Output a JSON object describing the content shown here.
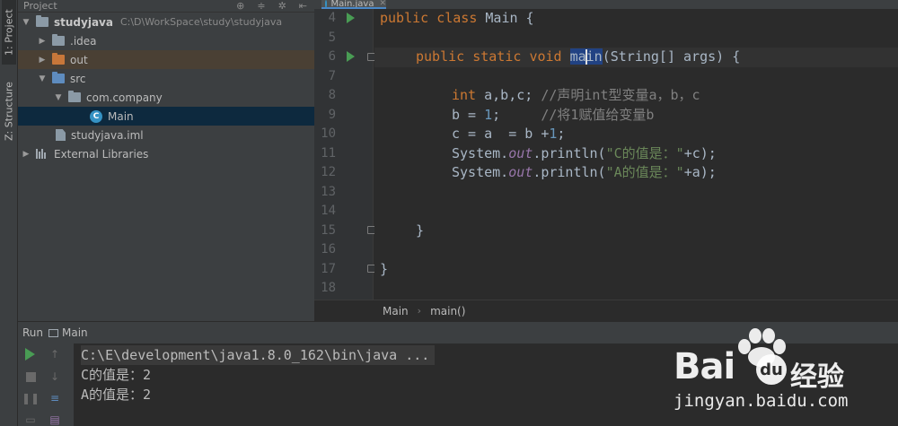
{
  "left_strip": {
    "project_tab": "1: Project",
    "structure_tab": "Z: Structure"
  },
  "project_panel": {
    "header_title": "Project",
    "tree": [
      {
        "label": "studyjava",
        "path": "C:\\D\\WorkSpace\\study\\studyjava",
        "icon": "project-folder-icon"
      },
      {
        "label": ".idea",
        "icon": "folder-icon"
      },
      {
        "label": "out",
        "icon": "folder-orange-icon"
      },
      {
        "label": "src",
        "icon": "source-folder-icon"
      },
      {
        "label": "com.company",
        "icon": "package-icon"
      },
      {
        "label": "Main",
        "icon": "java-class-icon"
      },
      {
        "label": "studyjava.iml",
        "icon": "iml-file-icon"
      },
      {
        "label": "External Libraries",
        "icon": "libraries-icon"
      }
    ]
  },
  "editor": {
    "tab_label": "Main.java",
    "line_numbers": [
      "4",
      "5",
      "6",
      "7",
      "8",
      "9",
      "10",
      "11",
      "12",
      "13",
      "14",
      "15",
      "16",
      "17",
      "18"
    ],
    "lines": {
      "l4_kw1": "public",
      "l4_kw2": "class",
      "l4_rest": " Main {",
      "l6_kw1": "public",
      "l6_kw2": "static",
      "l6_kw3": "void",
      "l6_m1": "ma",
      "l6_m2": "in",
      "l6_rest": "(String[] args) {",
      "l8_kw": "int",
      "l8_code": " a,b,c; ",
      "l8_cmt": "//声明int型变量a，b，c",
      "l9_code1": "b = ",
      "l9_num": "1",
      "l9_code2": ";     ",
      "l9_cmt": "//将1赋值给变量b",
      "l10_code1": "c = a  = b +",
      "l10_num": "1",
      "l10_code2": ";",
      "l11_code1": "System.",
      "l11_fld": "out",
      "l11_code2": ".println(",
      "l11_str": "\"C的值是：\"",
      "l11_code3": "+c);",
      "l12_code1": "System.",
      "l12_fld": "out",
      "l12_code2": ".println(",
      "l12_str": "\"A的值是：\"",
      "l12_code3": "+a);",
      "l15": "}",
      "l17": "}"
    },
    "breadcrumb": [
      "Main",
      "main()"
    ]
  },
  "run_panel": {
    "title": "Run",
    "config": "Main",
    "console": [
      "C:\\E\\development\\java1.8.0_162\\bin\\java ...",
      "C的值是：2",
      "A的值是：2"
    ]
  },
  "watermark": {
    "logo": "Bai",
    "du": "du",
    "cn": "经验",
    "url": "jingyan.baidu.com"
  },
  "colors": {
    "keyword": "#cc7832",
    "number": "#6897bb",
    "string": "#6a8759",
    "comment": "#808080",
    "field": "#9876aa",
    "run_green": "#499c54"
  }
}
